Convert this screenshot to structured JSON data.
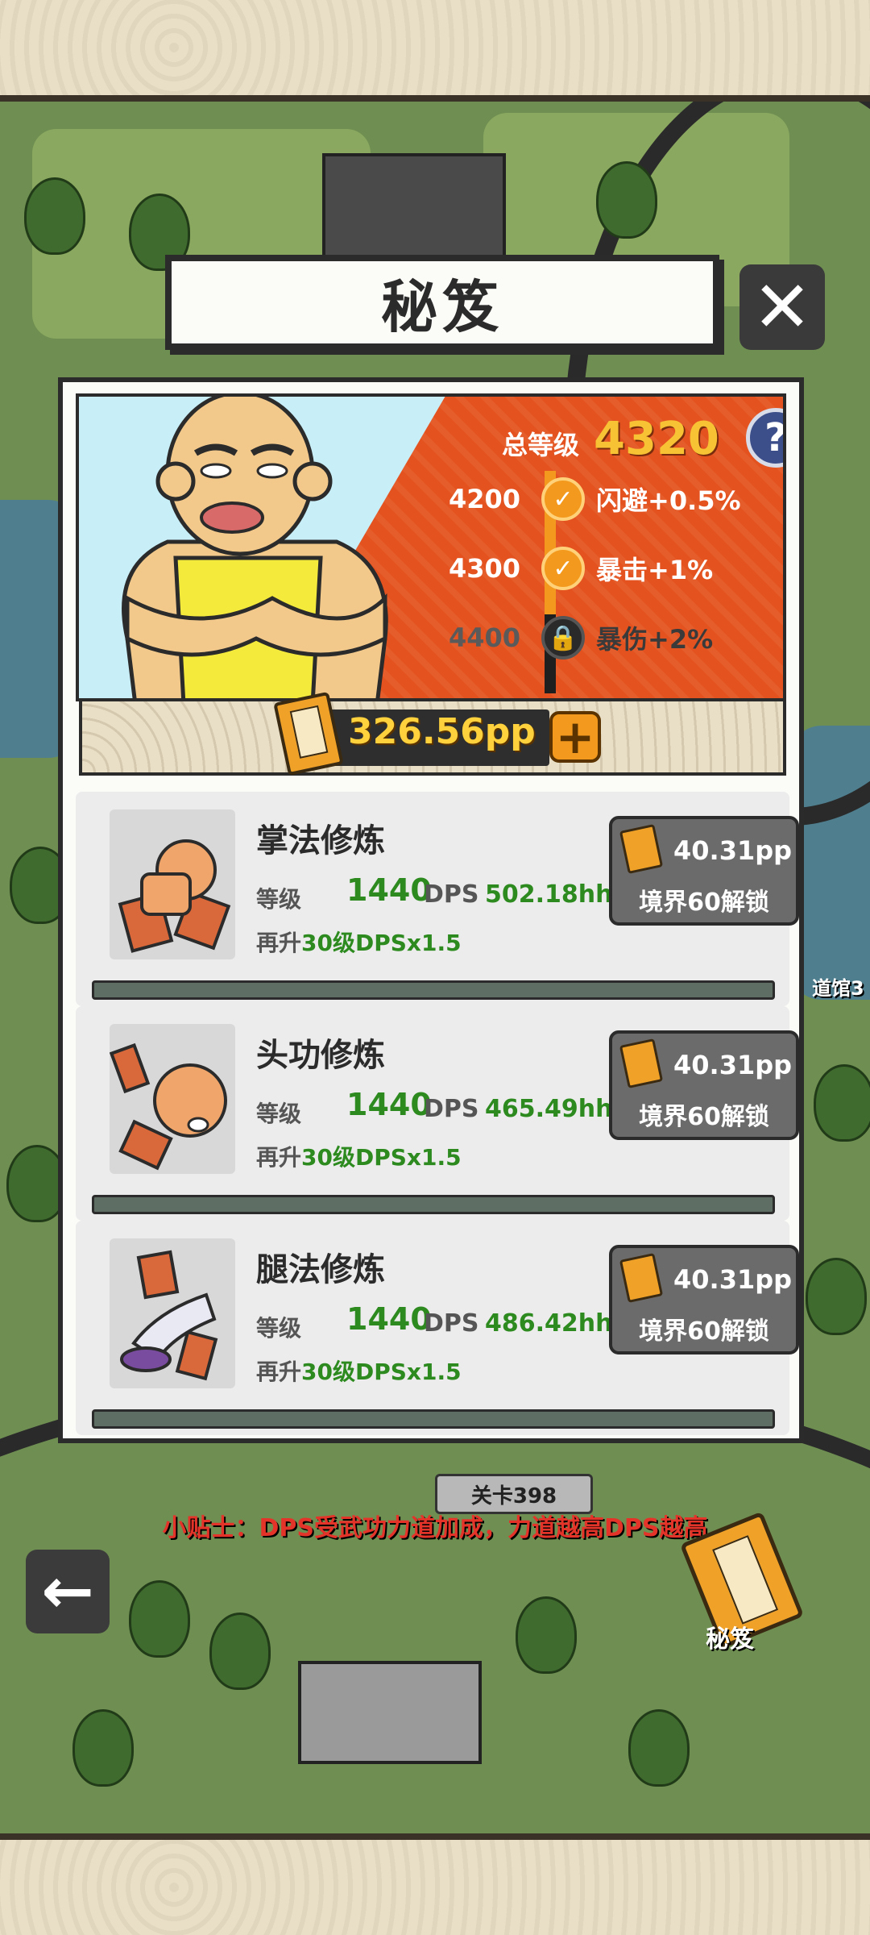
{
  "title": "秘笈",
  "header": {
    "total_label": "总等级",
    "total_value": "4320",
    "help": "?",
    "milestones": [
      {
        "level": "4200",
        "bonus": "闪避+0.5%",
        "state": "done"
      },
      {
        "level": "4300",
        "bonus": "暴击+1%",
        "state": "done"
      },
      {
        "level": "4400",
        "bonus": "暴伤+2%",
        "state": "locked"
      }
    ]
  },
  "pp": {
    "value": "326.56pp",
    "plus": "+"
  },
  "skills": [
    {
      "name": "掌法修炼",
      "level_label": "等级",
      "level": "1440",
      "dps_label": "DPS",
      "dps": "502.18hh",
      "next_prefix": "再升",
      "next_levels": "30级",
      "next_bonus": "DPSx1.5",
      "cost": "40.31pp",
      "unlock": "境界60解锁"
    },
    {
      "name": "头功修炼",
      "level_label": "等级",
      "level": "1440",
      "dps_label": "DPS",
      "dps": "465.49hh",
      "next_prefix": "再升",
      "next_levels": "30级",
      "next_bonus": "DPSx1.5",
      "cost": "40.31pp",
      "unlock": "境界60解锁"
    },
    {
      "name": "腿法修炼",
      "level_label": "等级",
      "level": "1440",
      "dps_label": "DPS",
      "dps": "486.42hh",
      "next_prefix": "再升",
      "next_levels": "30级",
      "next_bonus": "DPSx1.5",
      "cost": "40.31pp",
      "unlock": "境界60解锁"
    }
  ],
  "tip": "小贴士：DPS受武功力道加成，力道越高DPS越高",
  "stage_tag": "关卡398",
  "side_label": "道馆3",
  "manual_label": "秘笈",
  "icons": {
    "close": "close-icon",
    "help": "help-icon",
    "back": "back-arrow-icon",
    "check": "check-icon",
    "lock": "lock-icon",
    "book": "secret-book-icon"
  },
  "colors": {
    "header_red": "#e4531f",
    "gold": "#f7c234",
    "green": "#2c8a1e",
    "tip_red": "#e4342a"
  }
}
